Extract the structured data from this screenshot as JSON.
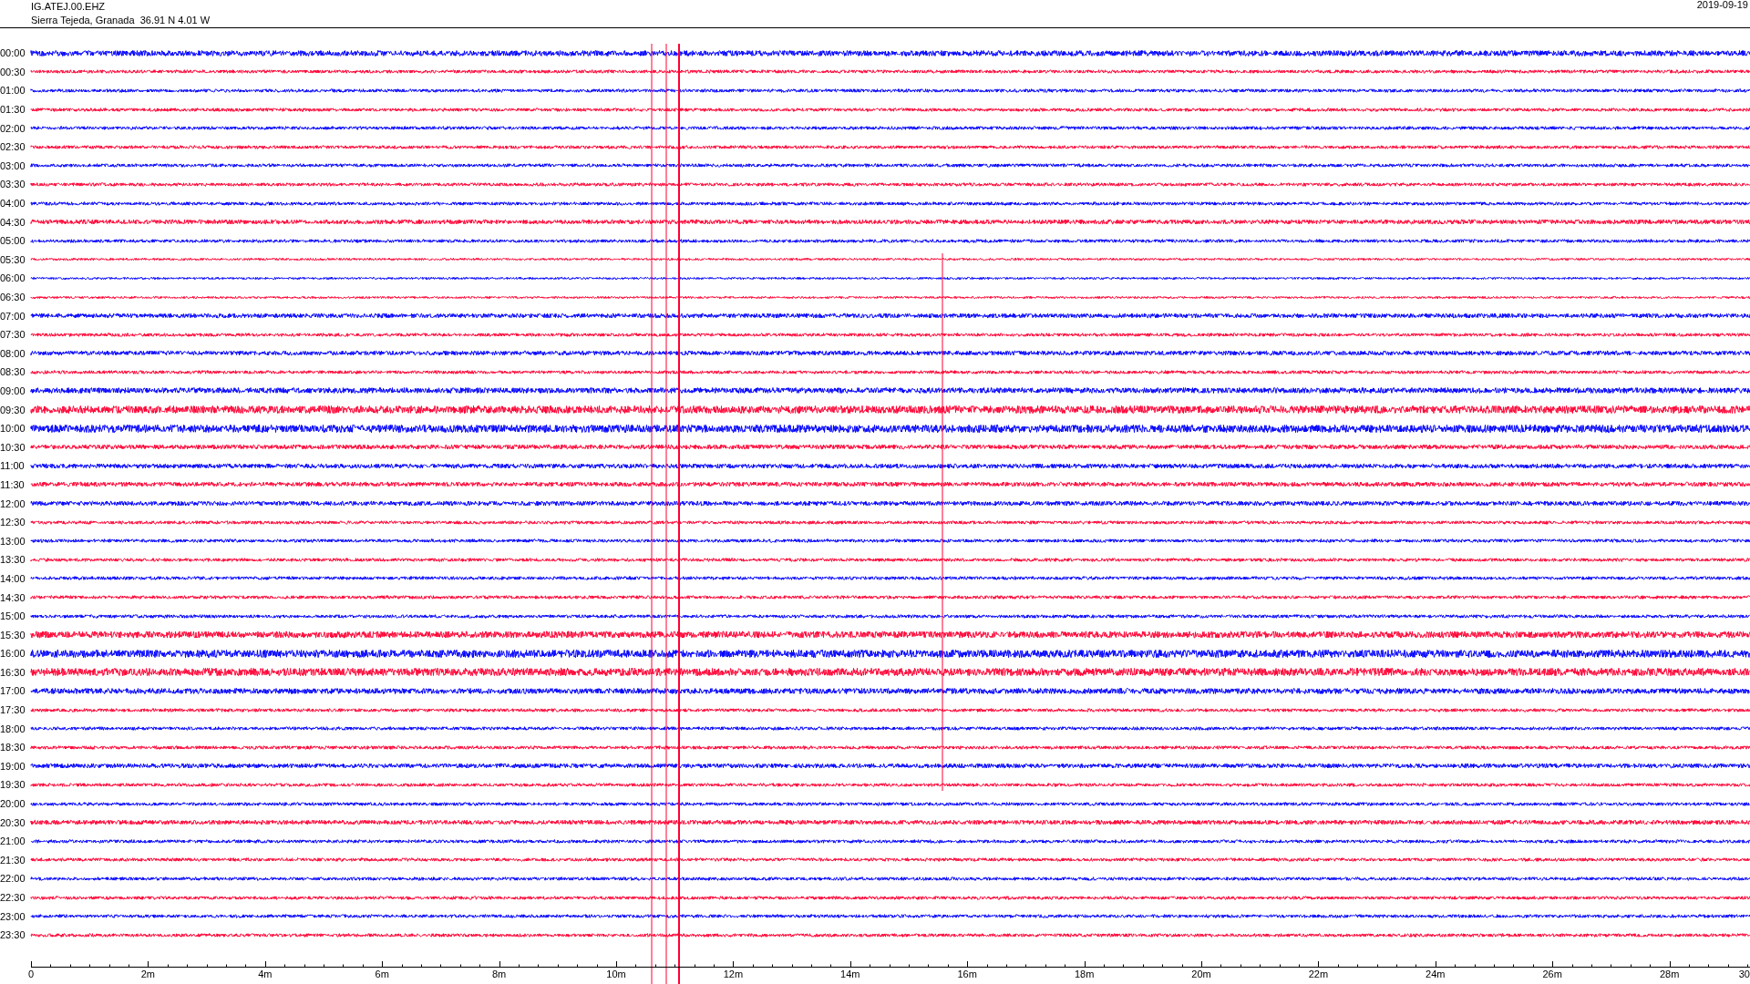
{
  "header": {
    "channel": "IG.ATEJ.00.EHZ",
    "station": "Sierra Tejeda, Granada  36.91 N 4.01 W",
    "date": "2019-09-19"
  },
  "rows": [
    {
      "label": "00:00",
      "color": "#0000ff"
    },
    {
      "label": "00:30",
      "color": "#ff0033"
    },
    {
      "label": "01:00",
      "color": "#0000ff"
    },
    {
      "label": "01:30",
      "color": "#ff0033"
    },
    {
      "label": "02:00",
      "color": "#0000ff"
    },
    {
      "label": "02:30",
      "color": "#ff0033"
    },
    {
      "label": "03:00",
      "color": "#0000ff"
    },
    {
      "label": "03:30",
      "color": "#ff0033"
    },
    {
      "label": "04:00",
      "color": "#0000ff"
    },
    {
      "label": "04:30",
      "color": "#ff0033"
    },
    {
      "label": "05:00",
      "color": "#0000ff"
    },
    {
      "label": "05:30",
      "color": "#ff0033"
    },
    {
      "label": "06:00",
      "color": "#0000ff"
    },
    {
      "label": "06:30",
      "color": "#ff0033"
    },
    {
      "label": "07:00",
      "color": "#0000ff"
    },
    {
      "label": "07:30",
      "color": "#ff0033"
    },
    {
      "label": "08:00",
      "color": "#0000ff"
    },
    {
      "label": "08:30",
      "color": "#ff0033"
    },
    {
      "label": "09:00",
      "color": "#0000ff"
    },
    {
      "label": "09:30",
      "color": "#ff0033"
    },
    {
      "label": "10:00",
      "color": "#0000ff"
    },
    {
      "label": "10:30",
      "color": "#ff0033"
    },
    {
      "label": "11:00",
      "color": "#0000ff"
    },
    {
      "label": "11:30",
      "color": "#ff0033"
    },
    {
      "label": "12:00",
      "color": "#0000ff"
    },
    {
      "label": "12:30",
      "color": "#ff0033"
    },
    {
      "label": "13:00",
      "color": "#0000ff"
    },
    {
      "label": "13:30",
      "color": "#ff0033"
    },
    {
      "label": "14:00",
      "color": "#0000ff"
    },
    {
      "label": "14:30",
      "color": "#ff0033"
    },
    {
      "label": "15:00",
      "color": "#0000ff"
    },
    {
      "label": "15:30",
      "color": "#ff0033"
    },
    {
      "label": "16:00",
      "color": "#0000ff"
    },
    {
      "label": "16:30",
      "color": "#ff0033"
    },
    {
      "label": "17:00",
      "color": "#0000ff"
    },
    {
      "label": "17:30",
      "color": "#ff0033"
    },
    {
      "label": "18:00",
      "color": "#0000ff"
    },
    {
      "label": "18:30",
      "color": "#ff0033"
    },
    {
      "label": "19:00",
      "color": "#0000ff"
    },
    {
      "label": "19:30",
      "color": "#ff0033"
    },
    {
      "label": "20:00",
      "color": "#0000ff"
    },
    {
      "label": "20:30",
      "color": "#ff0033"
    },
    {
      "label": "21:00",
      "color": "#0000ff"
    },
    {
      "label": "21:30",
      "color": "#ff0033"
    },
    {
      "label": "22:00",
      "color": "#0000ff"
    },
    {
      "label": "22:30",
      "color": "#ff0033"
    },
    {
      "label": "23:00",
      "color": "#0000ff"
    },
    {
      "label": "23:30",
      "color": "#ff0033"
    }
  ],
  "time_axis": {
    "labels": [
      "0",
      "2m",
      "4m",
      "6m",
      "8m",
      "10m",
      "12m",
      "14m",
      "16m",
      "18m",
      "20m",
      "22m",
      "24m",
      "26m",
      "28m",
      "30"
    ]
  }
}
